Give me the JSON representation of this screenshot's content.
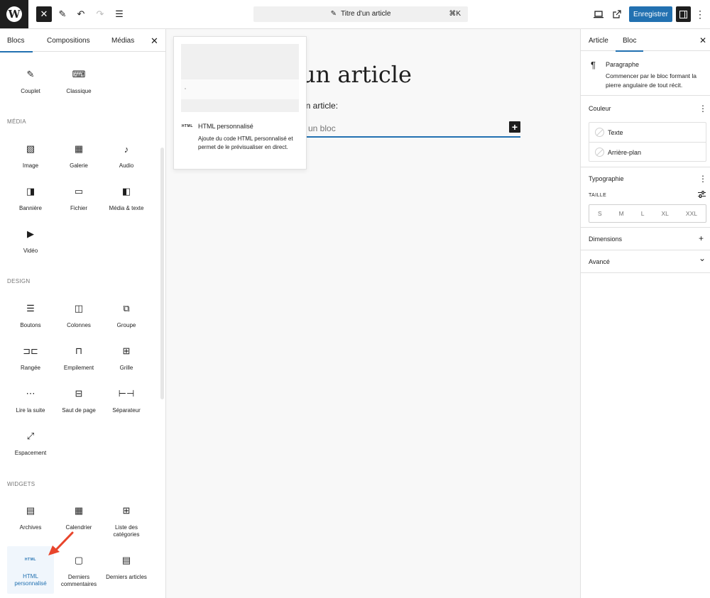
{
  "topbar": {
    "logo": "W",
    "close": "✕",
    "pen": "✎",
    "undo": "↶",
    "redo": "↷",
    "list_view": "☰",
    "command": {
      "title": "Titre d'un article",
      "shortcut": "⌘K"
    },
    "save_label": "Enregistrer",
    "kebab": "⋮"
  },
  "inserter": {
    "tabs": [
      "Blocs",
      "Compositions",
      "Médias"
    ],
    "close": "✕",
    "sections": {
      "media": "MÉDIA",
      "design": "DESIGN",
      "widgets": "WIDGETS"
    },
    "text_blocks": [
      {
        "label": "Couplet",
        "icon": "✎"
      },
      {
        "label": "Classique",
        "icon": "⌨"
      }
    ],
    "media_blocks": [
      {
        "label": "Image",
        "icon": "▧"
      },
      {
        "label": "Galerie",
        "icon": "▦"
      },
      {
        "label": "Audio",
        "icon": "♪"
      },
      {
        "label": "Bannière",
        "icon": "◨"
      },
      {
        "label": "Fichier",
        "icon": "▭"
      },
      {
        "label": "Média & texte",
        "icon": "◧"
      },
      {
        "label": "Vidéo",
        "icon": "▶"
      }
    ],
    "design_blocks": [
      {
        "label": "Boutons",
        "icon": "☰"
      },
      {
        "label": "Colonnes",
        "icon": "◫"
      },
      {
        "label": "Groupe",
        "icon": "⧉"
      },
      {
        "label": "Rangée",
        "icon": "⊐⊏"
      },
      {
        "label": "Empilement",
        "icon": "⊓"
      },
      {
        "label": "Grille",
        "icon": "⊞"
      },
      {
        "label": "Lire la suite",
        "icon": "⋯"
      },
      {
        "label": "Saut de page",
        "icon": "⊟"
      },
      {
        "label": "Séparateur",
        "icon": "⊢⊣"
      },
      {
        "label": "Espacement",
        "icon": "⤢"
      }
    ],
    "widget_blocks": [
      {
        "label": "Archives",
        "icon": "▤"
      },
      {
        "label": "Calendrier",
        "icon": "▦"
      },
      {
        "label": "Liste des catégories",
        "icon": "⊞"
      },
      {
        "label": "HTML personnalisé",
        "icon": "HTML"
      },
      {
        "label": "Derniers commentaires",
        "icon": "▢"
      },
      {
        "label": "Derniers articles",
        "icon": "▤"
      }
    ]
  },
  "editor": {
    "title_fragment": "un article",
    "paragraph_fragment": "un article:",
    "block_placeholder_fragment": "ir un bloc",
    "add_block": "+"
  },
  "popover": {
    "icon": "HTML",
    "title": "HTML personnalisé",
    "description": "Ajoute du code HTML personnalisé et permet de le prévisualiser en direct."
  },
  "sidebar": {
    "tabs": [
      "Article",
      "Bloc"
    ],
    "close": "✕",
    "block": {
      "icon": "¶",
      "title": "Paragraphe",
      "description": "Commencer par le bloc formant la pierre angulaire de tout récit."
    },
    "color": {
      "title": "Couleur",
      "items": [
        "Texte",
        "Arrière-plan"
      ]
    },
    "typography": {
      "title": "Typographie",
      "size_label": "TAILLE",
      "sizes": [
        "S",
        "M",
        "L",
        "XL",
        "XXL"
      ]
    },
    "dimensions": {
      "title": "Dimensions",
      "icon": "+"
    },
    "advanced": {
      "title": "Avancé",
      "icon": "⌄"
    }
  },
  "colors": {
    "accent": "#2271b1",
    "dark": "#1e1e1e",
    "border": "#e0e0e0",
    "canvas": "#f8f8f8",
    "arrow": "#e8452c"
  }
}
